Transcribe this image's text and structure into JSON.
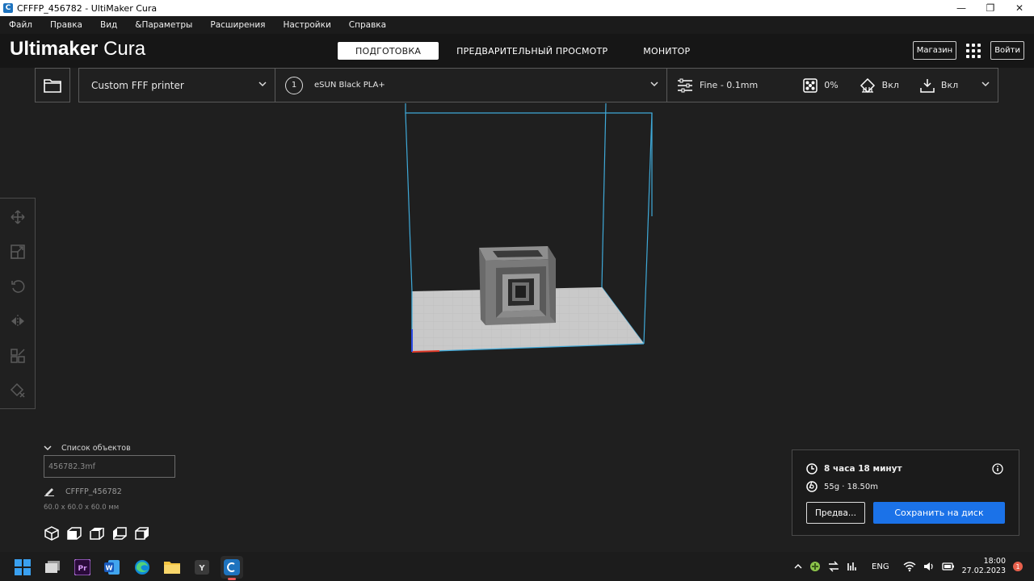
{
  "window": {
    "title": "CFFFP_456782 - UltiMaker Cura",
    "minimize": "—",
    "maximize": "❐",
    "close": "✕"
  },
  "menu": [
    "Файл",
    "Правка",
    "Вид",
    "&Параметры",
    "Расширения",
    "Настройки",
    "Справка"
  ],
  "header": {
    "logo_bold": "Ultimaker",
    "logo_light": "Cura",
    "tabs": [
      "ПОДГОТОВКА",
      "ПРЕДВАРИТЕЛЬНЫЙ ПРОСМОТР",
      "МОНИТОР"
    ],
    "active_tab": 0,
    "marketplace": "Магазин",
    "signin": "Войти"
  },
  "toolbar": {
    "printer": "Custom FFF printer",
    "extruder_number": "1",
    "material": "eSUN Black PLA+",
    "profile": "Fine - 0.1mm",
    "infill": "0%",
    "support": "Вкл",
    "adhesion": "Вкл"
  },
  "object_list": {
    "header": "Список объектов",
    "file": "456782.3mf",
    "object_name": "CFFFP_456782",
    "dimensions": "60.0 x 60.0 x 60.0 мм"
  },
  "print_info": {
    "time": "8 часа 18 минут",
    "material_usage": "55g · 18.50m",
    "preview_button": "Предва...",
    "save_button": "Сохранить на диск"
  },
  "taskbar": {
    "language": "ENG",
    "time": "18:00",
    "date": "27.02.2023",
    "notifications": "1"
  },
  "colors": {
    "accent": "#1b72e8",
    "build_volume": "#3fa9d8",
    "background": "#1f1f1f"
  }
}
